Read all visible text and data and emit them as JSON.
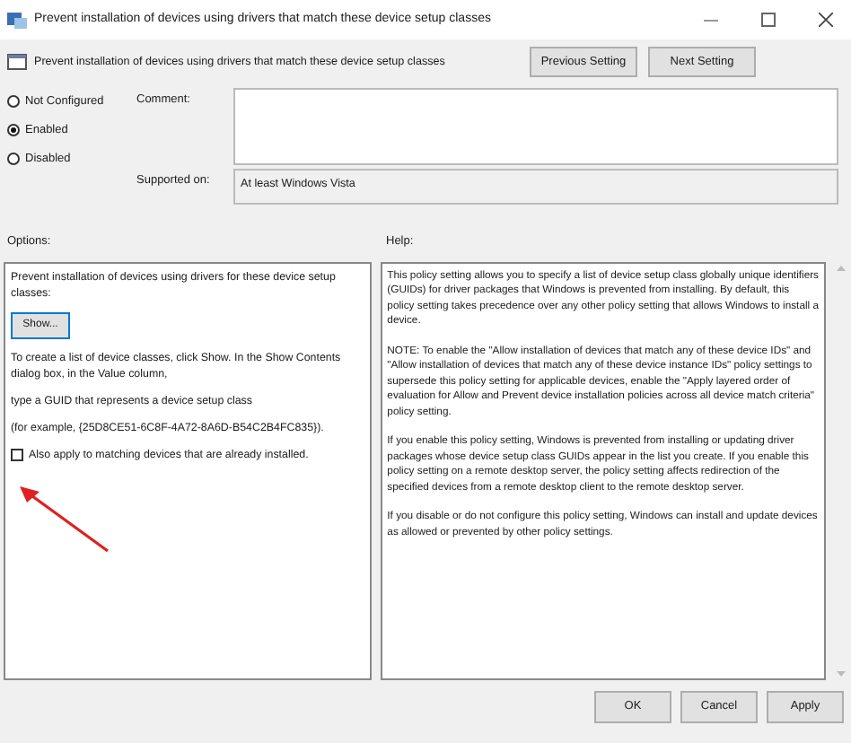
{
  "window": {
    "title": "Prevent installation of devices using drivers that match these device setup classes"
  },
  "header": {
    "title": "Prevent installation of devices using drivers that match these device setup classes",
    "buttons": [
      "Previous Setting",
      "Next Setting"
    ]
  },
  "state_options": [
    {
      "label": "Not Configured",
      "selected": false
    },
    {
      "label": "Enabled",
      "selected": true
    },
    {
      "label": "Disabled",
      "selected": false
    }
  ],
  "comment": {
    "label": "Comment:"
  },
  "supported_on": {
    "label": "Supported on:",
    "value": "At least Windows Vista"
  },
  "options": {
    "label": "Options:",
    "description": "Prevent installation of devices using drivers for these device setup classes:",
    "show_button": "Show...",
    "lines": [
      "To create a list of device classes, click Show. In the Show Contents dialog box, in the Value column,",
      "type a GUID that represents a device setup class",
      "(for example, {25D8CE51-6C8F-4A72-8A6D-B54C2B4FC835})."
    ],
    "checkbox": {
      "label": "Also apply to matching devices that are already installed.",
      "checked": false
    }
  },
  "help": {
    "label": "Help:",
    "paragraphs": [
      "This policy setting allows you to specify a list of device setup class globally unique identifiers (GUIDs) for driver packages that Windows is prevented from installing. By default, this policy setting takes precedence over any other policy setting that allows Windows to install a device.",
      "NOTE: To enable the \"Allow installation of devices that match any of these device IDs\" and \"Allow installation of devices that match any of these device instance IDs\" policy settings to supersede this policy setting for applicable devices, enable the \"Apply layered order of evaluation for Allow and Prevent device installation policies across all device match criteria\" policy setting.",
      "If you enable this policy setting, Windows is prevented from installing or updating driver packages whose device setup class GUIDs appear in the list you create. If you enable this policy setting on a remote desktop server, the policy setting affects redirection of the specified devices from a remote desktop client to the remote desktop server.",
      "If you disable or do not configure this policy setting, Windows can install and update devices as allowed or prevented by other policy settings."
    ]
  },
  "footer_buttons": [
    "OK",
    "Cancel",
    "Apply"
  ]
}
